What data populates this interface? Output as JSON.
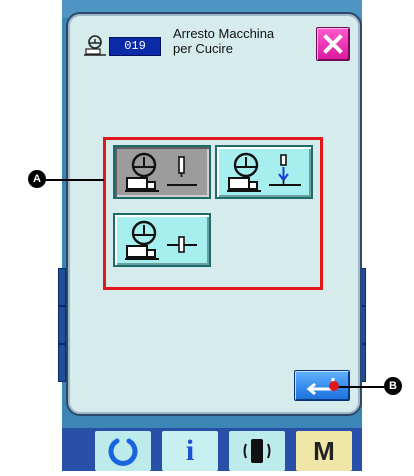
{
  "dialog": {
    "number": "019",
    "title_line1": "Arresto Macchina",
    "title_line2": "per Cucire"
  },
  "callouts": {
    "a_label": "A",
    "b_label": "B"
  },
  "bottom_bar": {
    "info_label": "i",
    "menu_label": "M"
  },
  "colors": {
    "accent_red": "#e0181e",
    "option_selected": "#9c9c9c",
    "option_bg": "#a7eeee",
    "close_magenta": "#e0249f",
    "enter_blue": "#1a6fdc"
  },
  "icons": [
    "sewing-machine-icon",
    "close-icon",
    "enter-icon",
    "refresh-icon",
    "info-icon",
    "phone-icon"
  ]
}
